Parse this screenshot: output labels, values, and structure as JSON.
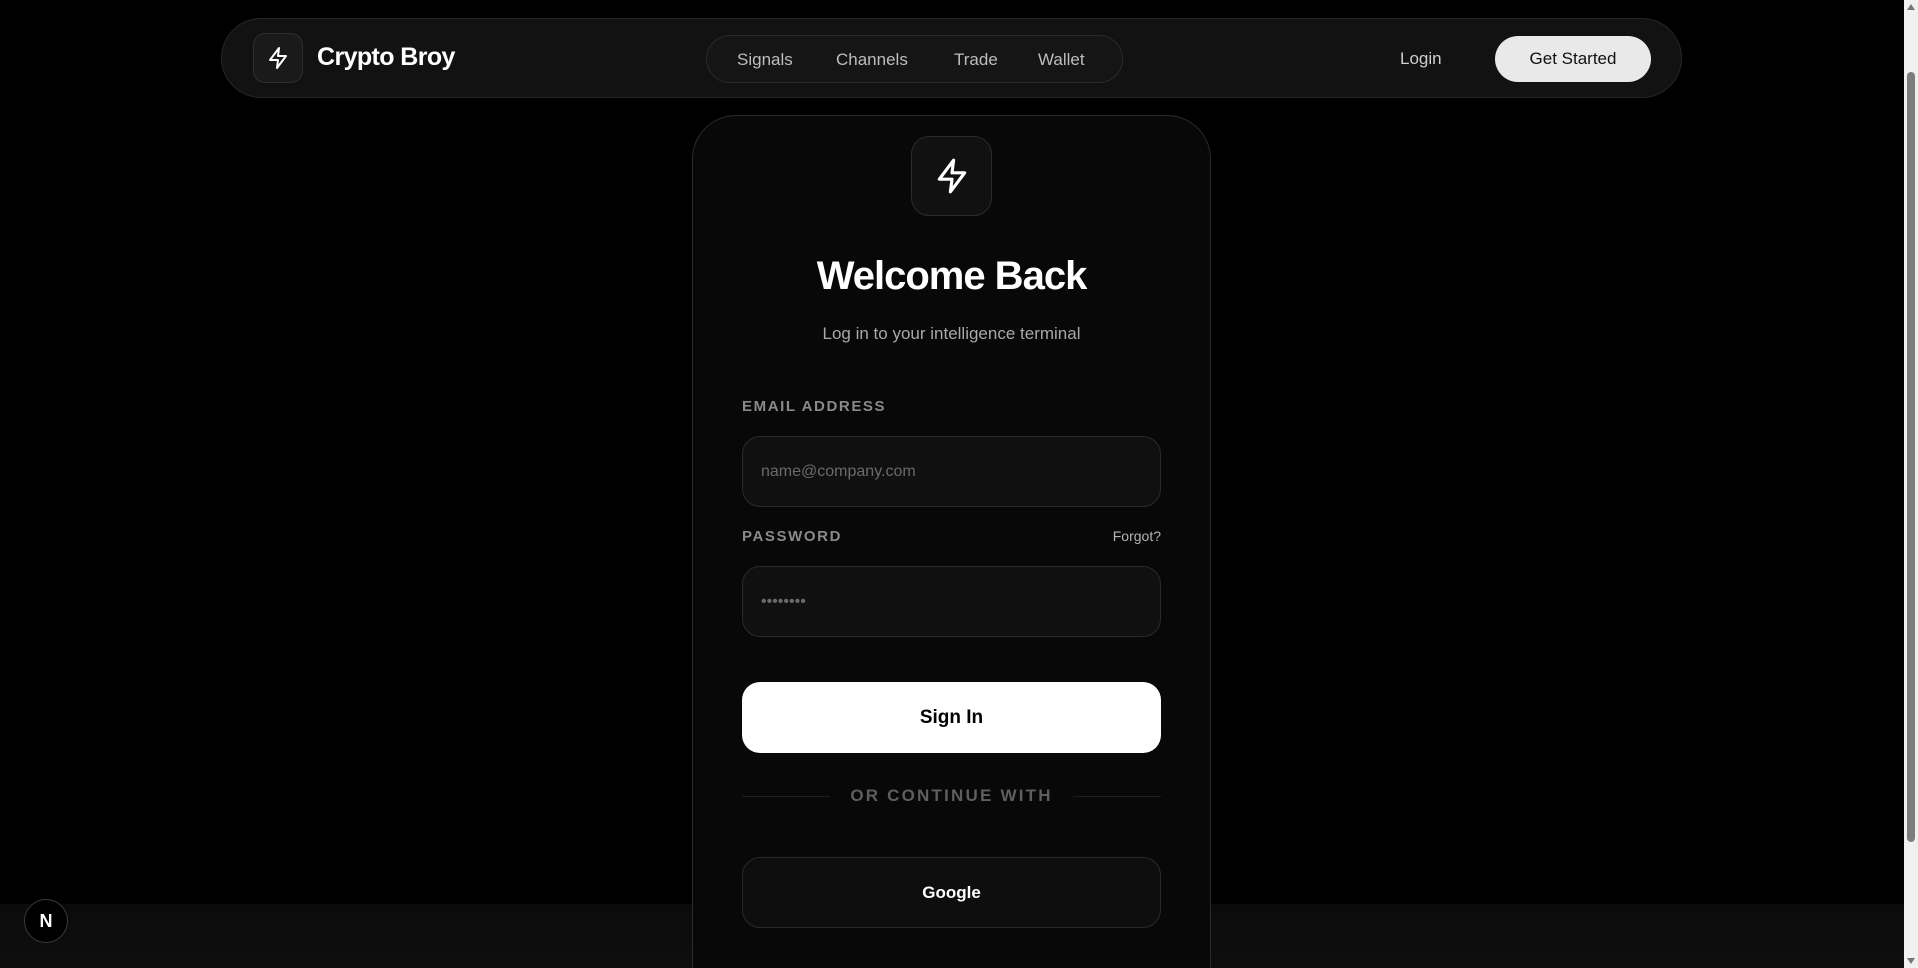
{
  "navbar": {
    "brand_name": "Crypto Broy",
    "brand_icon": "lightning-bolt-icon",
    "links": [
      "Signals",
      "Channels",
      "Trade",
      "Wallet"
    ],
    "login_label": "Login",
    "get_started_label": "Get Started"
  },
  "card": {
    "icon": "lightning-bolt-icon",
    "title": "Welcome Back",
    "subtitle": "Log in to your intelligence terminal",
    "email_label": "EMAIL ADDRESS",
    "email_placeholder": "name@company.com",
    "email_value": "",
    "password_label": "PASSWORD",
    "forgot_label": "Forgot?",
    "password_placeholder": "••••••••",
    "password_value": "",
    "sign_in_label": "Sign In",
    "divider_text": "OR CONTINUE WITH",
    "google_label": "Google"
  },
  "badge": {
    "letter": "N"
  },
  "colors": {
    "background": "#000000",
    "card_background": "#080808",
    "primary_button": "#ffffff",
    "muted_text": "#8a8a8a"
  }
}
